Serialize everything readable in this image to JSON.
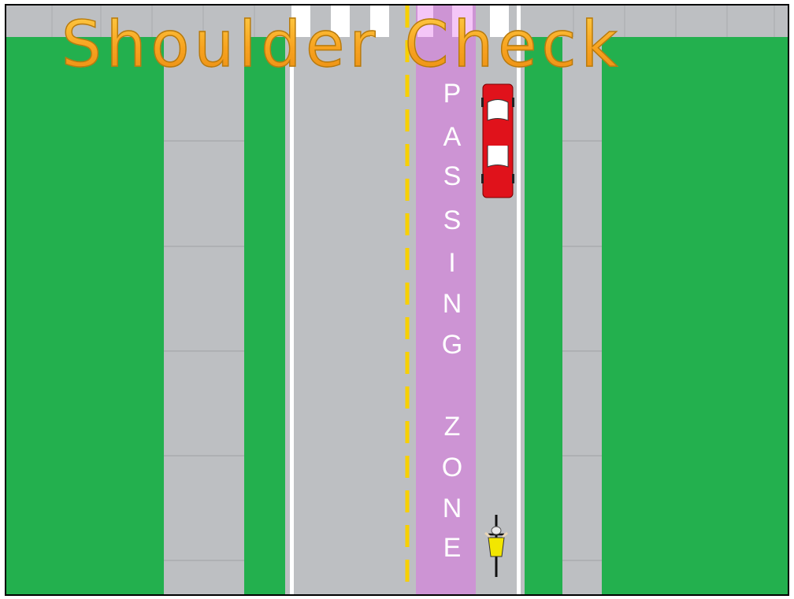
{
  "scene": {
    "title": "Shoulder Check",
    "zone_label": {
      "letters": [
        "P",
        "A",
        "S",
        "S",
        "I",
        "N",
        "G",
        "Z",
        "O",
        "N",
        "E"
      ]
    },
    "colors": {
      "grass": "#23b04e",
      "sidewalk": "#bdbfc2",
      "road": "#bdbfc2",
      "passing_zone": "#cd94d4",
      "center_line": "#f7d000",
      "edge_line": "#ffffff",
      "car": "#e0121b",
      "cyclist_jersey": "#f2e600",
      "title_fill": "#f7a21f"
    },
    "icons": [
      "car-icon",
      "cyclist-icon"
    ]
  }
}
